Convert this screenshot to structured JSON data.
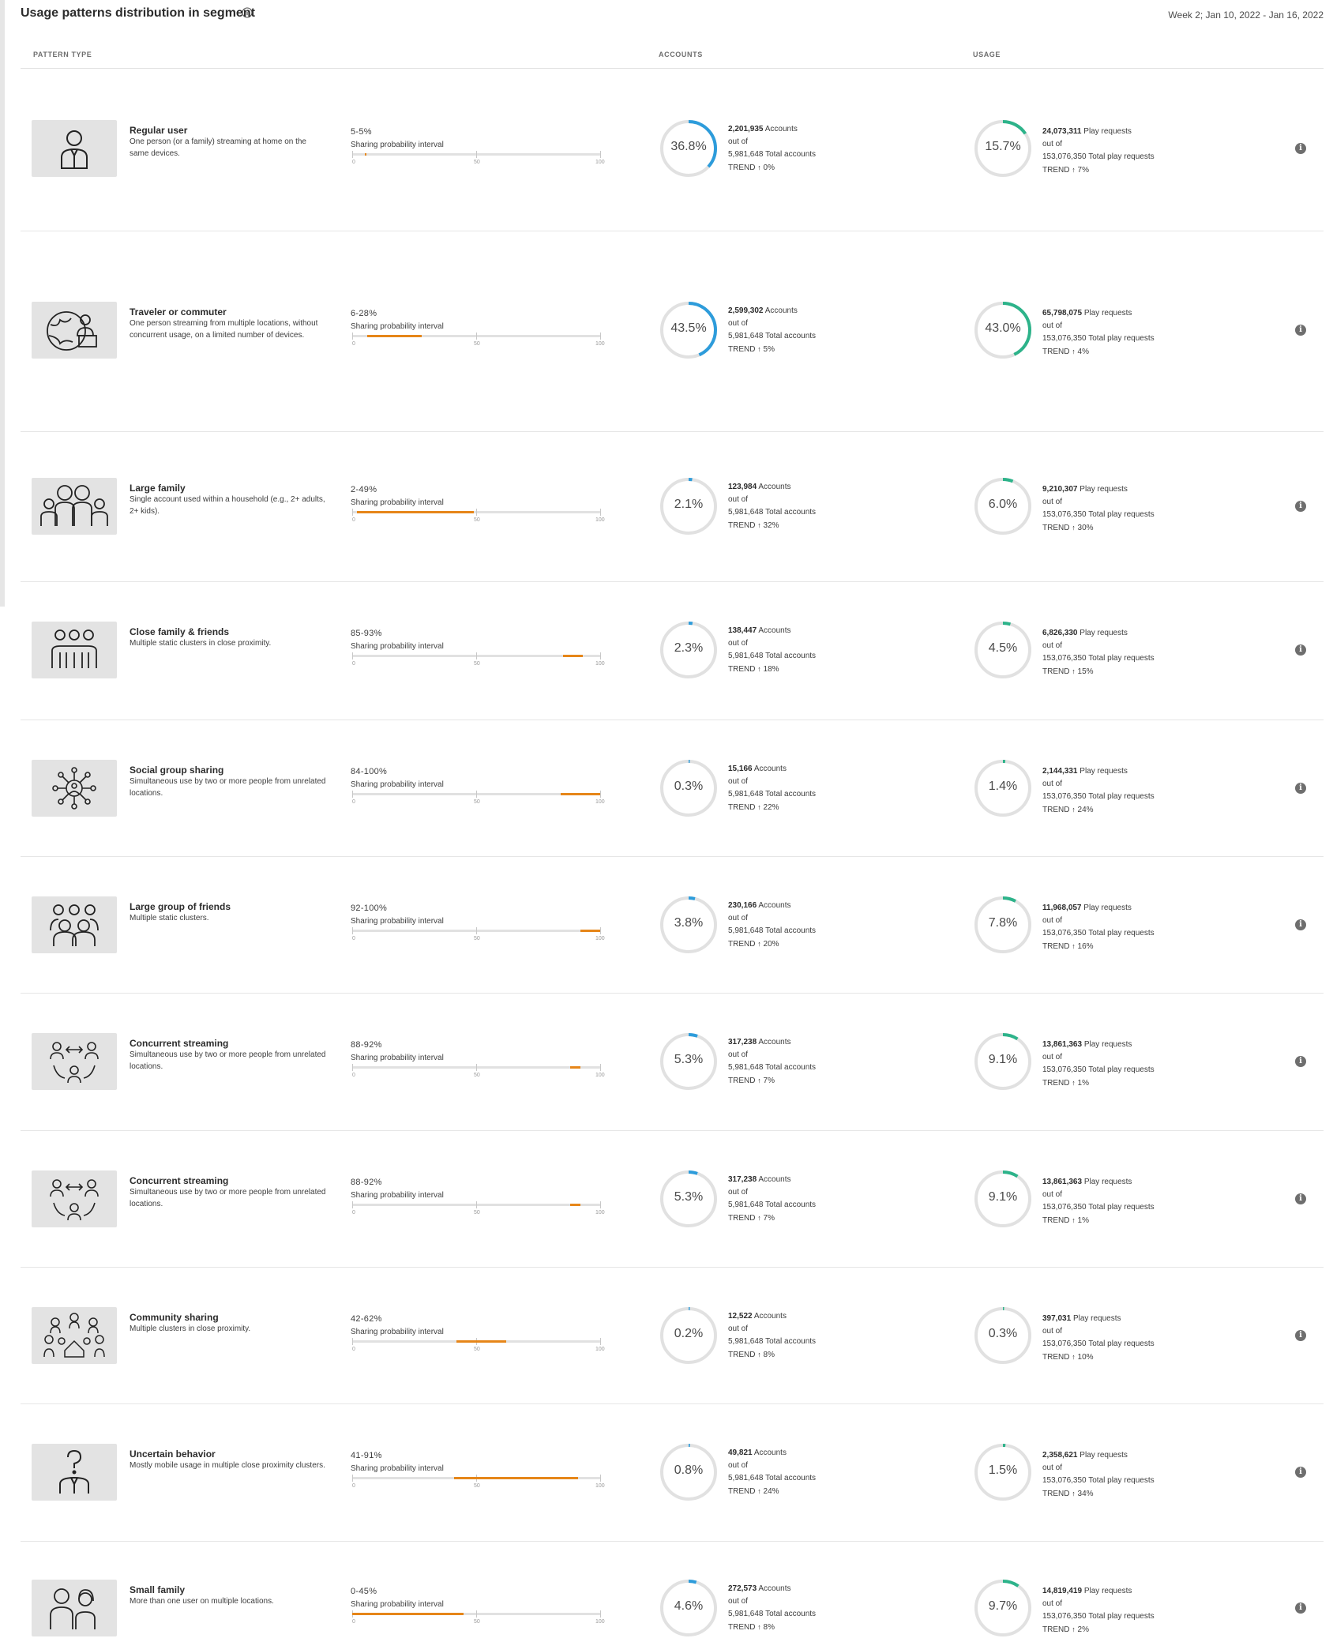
{
  "header": {
    "title": "Usage patterns distribution in segment",
    "date_range": "Week 2; Jan 10, 2022 - Jan 16, 2022"
  },
  "columns": {
    "pattern_type": "PATTERN TYPE",
    "accounts": "ACCOUNTS",
    "usage": "USAGE"
  },
  "common": {
    "interval_label": "Sharing probability interval",
    "tick_0": "0",
    "tick_50": "50",
    "tick_100": "100",
    "out_of": "out of",
    "accounts_suffix": "Accounts",
    "total_accounts_suffix": "Total accounts",
    "play_requests_suffix": "Play requests",
    "total_play_requests_suffix": "Total play requests",
    "trend_label": "TREND",
    "trend_arrow": "↑",
    "info_glyph": "i"
  },
  "colors": {
    "accounts_ring": "#2d9cdb",
    "usage_ring": "#2db38a",
    "interval_bar": "#e68619",
    "ring_track": "#e1e1e1"
  },
  "patterns": [
    {
      "icon": "single-person-icon",
      "title": "Regular user",
      "description": "One person (or a family) streaming at home on the same devices.",
      "range": "5-5%",
      "interval": [
        5,
        5
      ],
      "accounts": {
        "percent": "36.8%",
        "fraction": 0.368,
        "count": "2,201,935",
        "total": "5,981,648",
        "trend": "0%"
      },
      "usage": {
        "percent": "15.7%",
        "fraction": 0.157,
        "count": "24,073,311",
        "total": "153,076,350",
        "trend": "7%"
      }
    },
    {
      "icon": "globe-traveler-icon",
      "title": "Traveler or commuter",
      "description": "One person streaming from multiple locations, without concurrent usage, on a limited number of devices.",
      "range": "6-28%",
      "interval": [
        6,
        28
      ],
      "accounts": {
        "percent": "43.5%",
        "fraction": 0.435,
        "count": "2,599,302",
        "total": "5,981,648",
        "trend": "5%"
      },
      "usage": {
        "percent": "43.0%",
        "fraction": 0.43,
        "count": "65,798,075",
        "total": "153,076,350",
        "trend": "4%"
      }
    },
    {
      "icon": "large-family-icon",
      "title": "Large family",
      "description": "Single account used within a household (e.g., 2+ adults, 2+ kids).",
      "range": "2-49%",
      "interval": [
        2,
        49
      ],
      "accounts": {
        "percent": "2.1%",
        "fraction": 0.021,
        "count": "123,984",
        "total": "5,981,648",
        "trend": "32%"
      },
      "usage": {
        "percent": "6.0%",
        "fraction": 0.06,
        "count": "9,210,307",
        "total": "153,076,350",
        "trend": "30%"
      }
    },
    {
      "icon": "close-family-icon",
      "title": "Close family & friends",
      "description": "Multiple static clusters in close proximity.",
      "range": "85-93%",
      "interval": [
        85,
        93
      ],
      "accounts": {
        "percent": "2.3%",
        "fraction": 0.023,
        "count": "138,447",
        "total": "5,981,648",
        "trend": "18%"
      },
      "usage": {
        "percent": "4.5%",
        "fraction": 0.045,
        "count": "6,826,330",
        "total": "153,076,350",
        "trend": "15%"
      }
    },
    {
      "icon": "social-network-icon",
      "title": "Social group sharing",
      "description": "Simultaneous use by two or more people from unrelated locations.",
      "range": "84-100%",
      "interval": [
        84,
        100
      ],
      "accounts": {
        "percent": "0.3%",
        "fraction": 0.003,
        "count": "15,166",
        "total": "5,981,648",
        "trend": "22%"
      },
      "usage": {
        "percent": "1.4%",
        "fraction": 0.014,
        "count": "2,144,331",
        "total": "153,076,350",
        "trend": "24%"
      }
    },
    {
      "icon": "friends-group-icon",
      "title": "Large group of friends",
      "description": "Multiple static clusters.",
      "range": "92-100%",
      "interval": [
        92,
        100
      ],
      "accounts": {
        "percent": "3.8%",
        "fraction": 0.038,
        "count": "230,166",
        "total": "5,981,648",
        "trend": "20%"
      },
      "usage": {
        "percent": "7.8%",
        "fraction": 0.078,
        "count": "11,968,057",
        "total": "153,076,350",
        "trend": "16%"
      }
    },
    {
      "icon": "concurrent-streaming-icon",
      "title": "Concurrent streaming",
      "description": "Simultaneous use by two or more people from unrelated locations.",
      "range": "88-92%",
      "interval": [
        88,
        92
      ],
      "accounts": {
        "percent": "5.3%",
        "fraction": 0.053,
        "count": "317,238",
        "total": "5,981,648",
        "trend": "7%"
      },
      "usage": {
        "percent": "9.1%",
        "fraction": 0.091,
        "count": "13,861,363",
        "total": "153,076,350",
        "trend": "1%"
      }
    },
    {
      "icon": "concurrent-streaming-icon",
      "title": "Concurrent streaming",
      "description": "Simultaneous use by two or more people from unrelated locations.",
      "range": "88-92%",
      "interval": [
        88,
        92
      ],
      "accounts": {
        "percent": "5.3%",
        "fraction": 0.053,
        "count": "317,238",
        "total": "5,981,648",
        "trend": "7%"
      },
      "usage": {
        "percent": "9.1%",
        "fraction": 0.091,
        "count": "13,861,363",
        "total": "153,076,350",
        "trend": "1%"
      }
    },
    {
      "icon": "community-icon",
      "title": "Community sharing",
      "description": "Multiple clusters in close proximity.",
      "range": "42-62%",
      "interval": [
        42,
        62
      ],
      "accounts": {
        "percent": "0.2%",
        "fraction": 0.002,
        "count": "12,522",
        "total": "5,981,648",
        "trend": "8%"
      },
      "usage": {
        "percent": "0.3%",
        "fraction": 0.003,
        "count": "397,031",
        "total": "153,076,350",
        "trend": "10%"
      }
    },
    {
      "icon": "question-person-icon",
      "title": "Uncertain behavior",
      "description": "Mostly mobile usage in multiple close proximity clusters.",
      "range": "41-91%",
      "interval": [
        41,
        91
      ],
      "accounts": {
        "percent": "0.8%",
        "fraction": 0.008,
        "count": "49,821",
        "total": "5,981,648",
        "trend": "24%"
      },
      "usage": {
        "percent": "1.5%",
        "fraction": 0.015,
        "count": "2,358,621",
        "total": "153,076,350",
        "trend": "34%"
      }
    },
    {
      "icon": "small-family-icon",
      "title": "Small family",
      "description": "More than one user on multiple locations.",
      "range": "0-45%",
      "interval": [
        0,
        45
      ],
      "accounts": {
        "percent": "4.6%",
        "fraction": 0.046,
        "count": "272,573",
        "total": "5,981,648",
        "trend": "8%"
      },
      "usage": {
        "percent": "9.7%",
        "fraction": 0.097,
        "count": "14,819,419",
        "total": "153,076,350",
        "trend": "2%"
      }
    }
  ]
}
